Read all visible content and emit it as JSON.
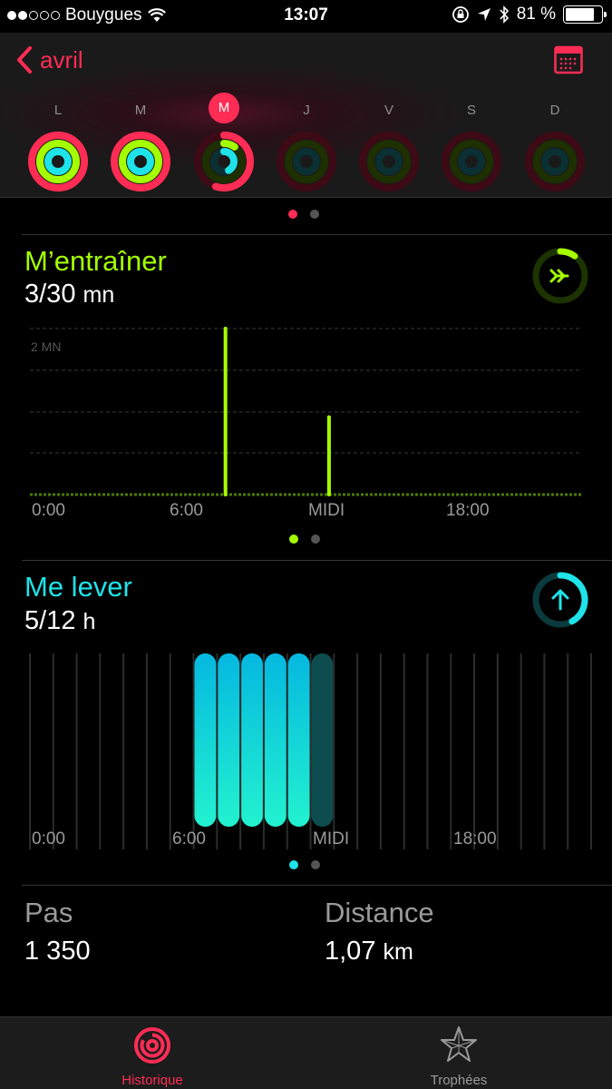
{
  "status_bar": {
    "carrier": "Bouygues",
    "time": "13:07",
    "battery": "81 %",
    "battery_level": 0.81
  },
  "header": {
    "back_label": "avril",
    "weekdays": [
      {
        "label": "L",
        "move": 1.0,
        "exercise": 1.0,
        "stand": 1.0,
        "selected": false
      },
      {
        "label": "M",
        "move": 1.0,
        "exercise": 1.0,
        "stand": 1.0,
        "selected": false
      },
      {
        "label": "M",
        "move": 0.55,
        "exercise": 0.1,
        "stand": 0.42,
        "selected": true
      },
      {
        "label": "J",
        "move": 0,
        "exercise": 0,
        "stand": 0,
        "selected": false
      },
      {
        "label": "V",
        "move": 0,
        "exercise": 0,
        "stand": 0,
        "selected": false
      },
      {
        "label": "S",
        "move": 0,
        "exercise": 0,
        "stand": 0,
        "selected": false
      },
      {
        "label": "D",
        "move": 0,
        "exercise": 0,
        "stand": 0,
        "selected": false
      }
    ]
  },
  "colors": {
    "move": "#ff2d55",
    "exercise": "#a4ff00",
    "stand": "#1ee3e8",
    "accent": "#ff2d55"
  },
  "exercise": {
    "title": "M’entraîner",
    "value": "3/30",
    "unit": "mn",
    "progress": 0.1,
    "y_label": "2 MN",
    "x_labels": [
      "0:00",
      "6:00",
      "MIDI",
      "18:00"
    ]
  },
  "stand": {
    "title": "Me lever",
    "value": "5/12",
    "unit": "h",
    "progress": 0.42,
    "x_labels": [
      "0:00",
      "6:00",
      "MIDI",
      "18:00"
    ]
  },
  "stats": {
    "steps_label": "Pas",
    "steps_value": "1 350",
    "distance_label": "Distance",
    "distance_value": "1,07",
    "distance_unit": "km"
  },
  "tabs": [
    {
      "label": "Historique",
      "active": true
    },
    {
      "label": "Trophées",
      "active": false
    }
  ],
  "chart_data": [
    {
      "type": "bar",
      "title": "M’entraîner",
      "ylabel": "2 MN",
      "x_range_hours": [
        0,
        24
      ],
      "x_ticks": [
        "0:00",
        "6:00",
        "MIDI",
        "18:00"
      ],
      "x": [
        8.5,
        13.0
      ],
      "values": [
        3.0,
        1.4
      ],
      "ylim": [
        0,
        3
      ]
    },
    {
      "type": "bar",
      "title": "Me lever",
      "x_range_hours": [
        0,
        24
      ],
      "x_ticks": [
        "0:00",
        "6:00",
        "MIDI",
        "18:00"
      ],
      "categories": [
        "7",
        "8",
        "9",
        "10",
        "11",
        "12"
      ],
      "values": [
        1,
        1,
        1,
        1,
        1,
        1
      ],
      "current_hour": "12"
    }
  ]
}
